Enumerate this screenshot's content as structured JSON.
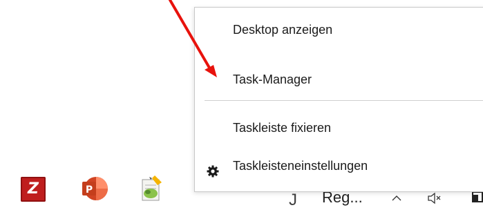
{
  "context_menu": {
    "items": [
      {
        "label": "Desktop anzeigen"
      },
      {
        "label": "Task-Manager"
      },
      {
        "label": "Taskleiste fixieren"
      },
      {
        "label": "Taskleisteneinstellungen",
        "icon": "gear-icon"
      }
    ]
  },
  "taskbar": {
    "apps": [
      {
        "name": "filezilla-icon",
        "glyph": "Z"
      },
      {
        "name": "powerpoint-icon",
        "glyph": "P"
      },
      {
        "name": "notepad-icon"
      }
    ],
    "partial_text_1": "J",
    "partial_text_2": "Reg...",
    "tray_icons": [
      "chevron-up-icon",
      "speaker-icon",
      "edge-icon"
    ]
  },
  "annotation": {
    "arrow_color": "#e8120c",
    "target": "Task-Manager"
  },
  "colors": {
    "filezilla": "#bf1e1e",
    "powerpoint": "#d04423",
    "menu_border": "#c8c8c8"
  }
}
